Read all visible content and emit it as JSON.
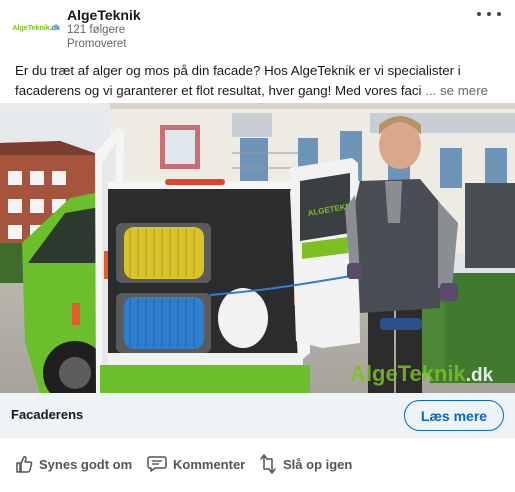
{
  "post": {
    "logo_text": "AlgeTeknik",
    "logo_suffix": ".dk",
    "company": "AlgeTeknik",
    "followers": "121 følgere",
    "promoted": "Promoveret",
    "text_line1": "Er du træt af alger og mos på din facade? Hos AlgeTeknik er vi specialister i",
    "text_line2": "facaderens og vi garanterer et flot resultat, hver gang! Med vores faci",
    "see_more": "... se mere"
  },
  "media": {
    "watermark": "AlgeTeknik",
    "watermark_suffix": ".dk",
    "door_text": "ALGETEKNIK"
  },
  "cta": {
    "title": "Facaderens",
    "button": "Læs mere"
  },
  "actions": {
    "like": "Synes godt om",
    "comment": "Kommenter",
    "share": "Slå op igen"
  },
  "icons": {
    "more": "more-horizontal-icon",
    "like": "thumbs-up-icon",
    "comment": "comment-icon",
    "share": "repost-icon"
  },
  "colors": {
    "brand_green": "#7cc11e",
    "link_blue": "#0a66c2",
    "cta_background": "#eef3f8"
  }
}
